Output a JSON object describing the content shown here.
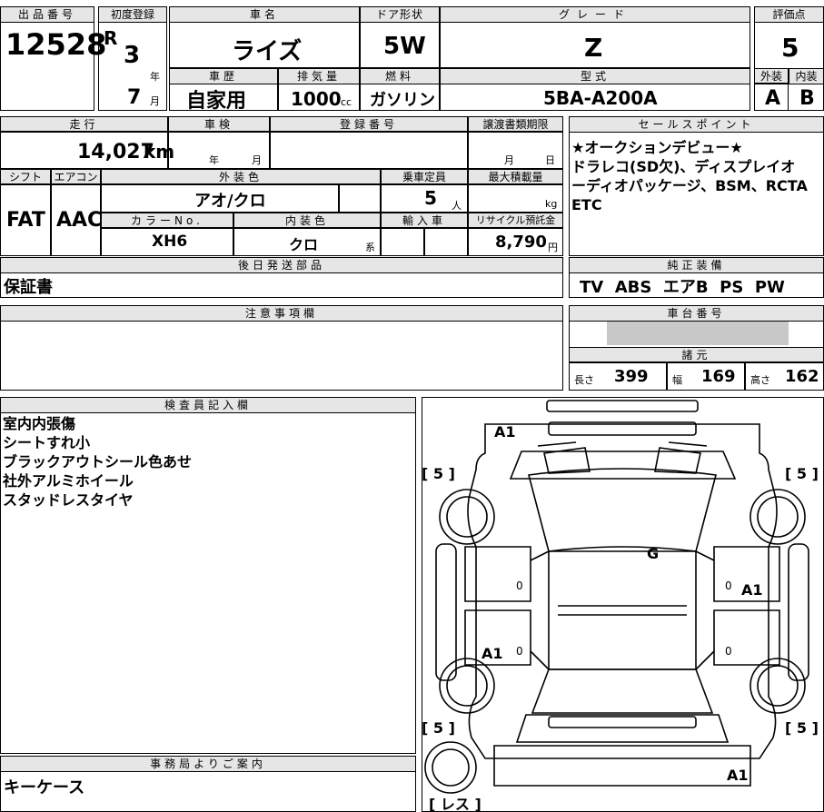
{
  "header": {
    "lot_no_label": "出品番号",
    "lot_no": "12528",
    "first_reg_label": "初度登録",
    "era": "R",
    "year": "3",
    "year_unit": "年",
    "month": "7",
    "month_unit": "月",
    "car_name_label": "車名",
    "car_name": "ライズ",
    "door_label": "ドア形状",
    "door": "5W",
    "grade_label": "グレード",
    "grade": "Z",
    "score_label": "評価点",
    "score": "5",
    "history_label": "車歴",
    "history": "自家用",
    "displacement_label": "排気量",
    "displacement": "1000",
    "displacement_unit": "cc",
    "fuel_label": "燃料",
    "fuel": "ガソリン",
    "model_label": "型式",
    "model": "5BA-A200A",
    "exterior_label": "外装",
    "exterior": "A",
    "interior_label": "内装",
    "interior": "B"
  },
  "specs": {
    "mileage_label": "走行",
    "mileage": "14,027",
    "mileage_unit": "km",
    "inspection_label": "車検",
    "insp_year_unit": "年",
    "insp_month_unit": "月",
    "regno_label": "登録番号",
    "transfer_label": "譲渡書類期限",
    "transfer_month": "月",
    "transfer_day": "日",
    "shift_label": "シフト",
    "shift": "FAT",
    "ac_label": "エアコン",
    "ac": "AAC",
    "ext_color_label": "外装色",
    "ext_color": "アオ/クロ",
    "capacity_label": "乗車定員",
    "capacity": "5",
    "capacity_unit": "人",
    "load_label": "最大積載量",
    "load_unit": "kg",
    "color_no_label": "カラーNo.",
    "color_no": "XH6",
    "int_color_label": "内装色",
    "int_color": "クロ",
    "int_color_unit": "系",
    "import_label": "輸入車",
    "recycle_label": "リサイクル預託金",
    "recycle": "8,790",
    "recycle_unit": "円"
  },
  "sales_point": {
    "label": "セールスポイント",
    "lines": [
      "★オークションデビュー★",
      "ドラレコ(SD欠)、ディスプレイオ",
      "ーディオパッケージ、BSM、RCTA",
      "ETC"
    ]
  },
  "later_parts": {
    "label": "後日発送部品",
    "value": "保証書"
  },
  "equipment": {
    "label": "純正装備",
    "value": "TV  ABS  エアB  PS  PW"
  },
  "notes": {
    "label": "注意事項欄"
  },
  "chassis": {
    "label": "車台番号",
    "dims_label": "諸元",
    "length_label": "長さ",
    "length": "399",
    "width_label": "幅",
    "width": "169",
    "height_label": "高さ",
    "height": "162"
  },
  "inspector": {
    "label": "検査員記入欄",
    "lines": [
      "室内内張傷",
      "シートすれ小",
      "ブラックアウトシール色あせ",
      "社外アルミホイール",
      "スタッドレスタイヤ"
    ]
  },
  "office": {
    "label": "事務局よりご案内",
    "value": "キーケース"
  },
  "diagram": {
    "tire_fl": "[ 5 ]",
    "tire_fr": "[ 5 ]",
    "tire_rl": "[ 5 ]",
    "tire_rr": "[ 5 ]",
    "spare": "[ レス ]",
    "mark_front": "A1",
    "mark_glass": "G",
    "mark_right_door": "A1",
    "mark_left_rear": "A1",
    "mark_rear": "A1",
    "zero1": "0",
    "zero2": "0",
    "zero3": "0",
    "zero4": "0"
  }
}
